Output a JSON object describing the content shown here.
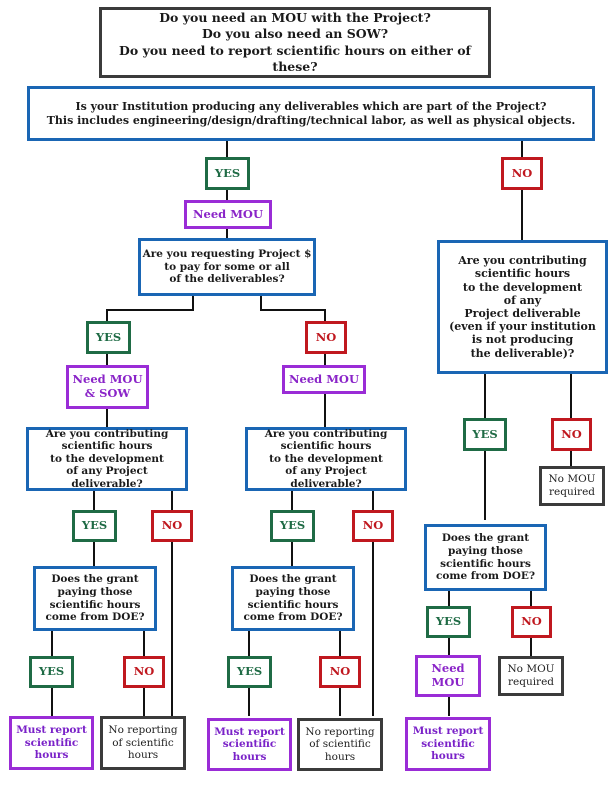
{
  "title": "Do you need an MOU with the Project?\nDo you also need an SOW?\nDo you need to report scientific hours on either of these?",
  "q_deliverables": "Is your Institution producing any deliverables which are part of the Project?\nThis includes engineering/design/drafting/technical labor, as well as physical objects.",
  "labels": {
    "yes": "YES",
    "no": "NO"
  },
  "branch_yes": {
    "outcome": "Need MOU",
    "q_project_funds": "Are you requesting Project $\nto pay for some or all\nof the deliverables?",
    "funds_yes": {
      "outcome": "Need MOU\n& SOW",
      "q_hours": "Are you contributing\nscientific hours\nto the development\nof any Project deliverable?",
      "q_doe": "Does the grant\npaying those\nscientific hours\ncome from DOE?",
      "result_report": "Must report\nscientific\nhours",
      "result_no_report": "No reporting\nof scientific\nhours"
    },
    "funds_no": {
      "outcome": "Need MOU",
      "q_hours": "Are you contributing\nscientific hours\nto the development\nof any Project deliverable?",
      "q_doe": "Does the grant\npaying those\nscientific hours\ncome from DOE?",
      "result_report": "Must report\nscientific\nhours",
      "result_no_report": "No reporting\nof scientific\nhours"
    }
  },
  "branch_no": {
    "q_hours": "Are you contributing\nscientific hours\nto the development\nof any\nProject deliverable\n(even if your institution\nis not producing\nthe deliverable)?",
    "hours_no_result": "No MOU\nrequired",
    "q_doe": "Does the grant\npaying those\nscientific hours\ncome from DOE?",
    "doe_yes_outcome": "Need\nMOU",
    "doe_yes_result": "Must report\nscientific\nhours",
    "doe_no_result": "No MOU\nrequired"
  },
  "colors": {
    "question_border": "#1a66b4",
    "yes": "#1f6b45",
    "no": "#c0181f",
    "need": "#9a2cd6",
    "neutral": "#3b3b3b"
  }
}
